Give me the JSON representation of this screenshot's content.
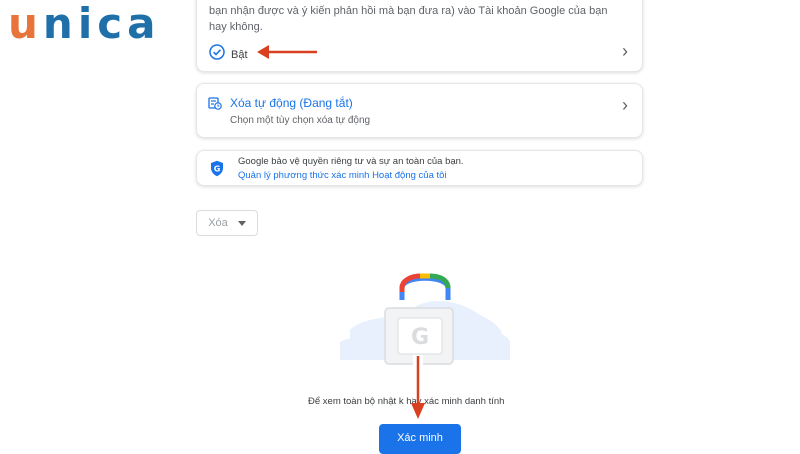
{
  "logo": {
    "part1": "u",
    "part2": "n",
    "part3": "i",
    "part4": "c",
    "part5": "a"
  },
  "activity_card": {
    "description": "bạn nhận được và ý kiến phản hồi mà bạn đưa ra) vào Tài khoản Google của bạn hay không.",
    "status_label": "Bật",
    "status_icon": "check-circle-icon"
  },
  "auto_delete_card": {
    "title": "Xóa tự động (Đang tắt)",
    "subtitle": "Chọn một tùy chọn xóa tự động",
    "icon": "auto-delete-icon"
  },
  "privacy_card": {
    "line1": "Google bảo vệ quyền riêng tư và sự an toàn của bạn.",
    "link": "Quản lý phương thức xác minh Hoạt động của tôi",
    "icon": "google-shield-icon"
  },
  "delete_dropdown": {
    "label": "Xóa"
  },
  "verify_section": {
    "text": "Để xem toàn bộ nhật k     hãy xác minh danh tính",
    "button_label": "Xác minh"
  },
  "colors": {
    "accent": "#1a73e8",
    "arrow": "#d9401f",
    "logo_orange": "#e8743b",
    "logo_blue": "#1f6fa9"
  }
}
